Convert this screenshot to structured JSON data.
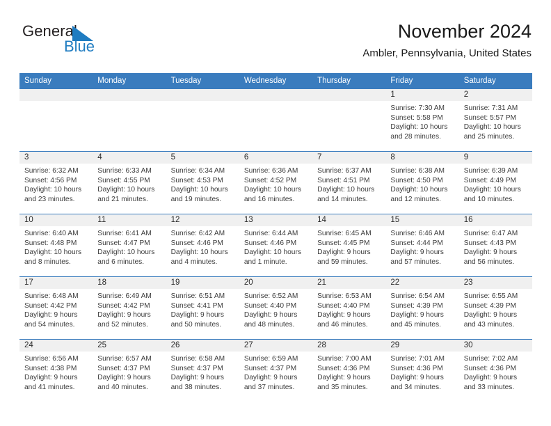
{
  "brand": {
    "name_part1": "General",
    "name_part2": "Blue",
    "triangle_color": "#1f7cc1",
    "text_color": "#231f20"
  },
  "header": {
    "title": "November 2024",
    "subtitle": "Ambler, Pennsylvania, United States"
  },
  "theme": {
    "header_blue": "#3a7cbe",
    "day_number_band": "#f0f0f0",
    "cell_background": "#ffffff",
    "body_text": "#3b3b3b"
  },
  "weekdays": [
    "Sunday",
    "Monday",
    "Tuesday",
    "Wednesday",
    "Thursday",
    "Friday",
    "Saturday"
  ],
  "weeks": [
    [
      {
        "day": "",
        "sunrise": "",
        "sunset": "",
        "daylight": ""
      },
      {
        "day": "",
        "sunrise": "",
        "sunset": "",
        "daylight": ""
      },
      {
        "day": "",
        "sunrise": "",
        "sunset": "",
        "daylight": ""
      },
      {
        "day": "",
        "sunrise": "",
        "sunset": "",
        "daylight": ""
      },
      {
        "day": "",
        "sunrise": "",
        "sunset": "",
        "daylight": ""
      },
      {
        "day": "1",
        "sunrise": "Sunrise: 7:30 AM",
        "sunset": "Sunset: 5:58 PM",
        "daylight": "Daylight: 10 hours and 28 minutes."
      },
      {
        "day": "2",
        "sunrise": "Sunrise: 7:31 AM",
        "sunset": "Sunset: 5:57 PM",
        "daylight": "Daylight: 10 hours and 25 minutes."
      }
    ],
    [
      {
        "day": "3",
        "sunrise": "Sunrise: 6:32 AM",
        "sunset": "Sunset: 4:56 PM",
        "daylight": "Daylight: 10 hours and 23 minutes."
      },
      {
        "day": "4",
        "sunrise": "Sunrise: 6:33 AM",
        "sunset": "Sunset: 4:55 PM",
        "daylight": "Daylight: 10 hours and 21 minutes."
      },
      {
        "day": "5",
        "sunrise": "Sunrise: 6:34 AM",
        "sunset": "Sunset: 4:53 PM",
        "daylight": "Daylight: 10 hours and 19 minutes."
      },
      {
        "day": "6",
        "sunrise": "Sunrise: 6:36 AM",
        "sunset": "Sunset: 4:52 PM",
        "daylight": "Daylight: 10 hours and 16 minutes."
      },
      {
        "day": "7",
        "sunrise": "Sunrise: 6:37 AM",
        "sunset": "Sunset: 4:51 PM",
        "daylight": "Daylight: 10 hours and 14 minutes."
      },
      {
        "day": "8",
        "sunrise": "Sunrise: 6:38 AM",
        "sunset": "Sunset: 4:50 PM",
        "daylight": "Daylight: 10 hours and 12 minutes."
      },
      {
        "day": "9",
        "sunrise": "Sunrise: 6:39 AM",
        "sunset": "Sunset: 4:49 PM",
        "daylight": "Daylight: 10 hours and 10 minutes."
      }
    ],
    [
      {
        "day": "10",
        "sunrise": "Sunrise: 6:40 AM",
        "sunset": "Sunset: 4:48 PM",
        "daylight": "Daylight: 10 hours and 8 minutes."
      },
      {
        "day": "11",
        "sunrise": "Sunrise: 6:41 AM",
        "sunset": "Sunset: 4:47 PM",
        "daylight": "Daylight: 10 hours and 6 minutes."
      },
      {
        "day": "12",
        "sunrise": "Sunrise: 6:42 AM",
        "sunset": "Sunset: 4:46 PM",
        "daylight": "Daylight: 10 hours and 4 minutes."
      },
      {
        "day": "13",
        "sunrise": "Sunrise: 6:44 AM",
        "sunset": "Sunset: 4:46 PM",
        "daylight": "Daylight: 10 hours and 1 minute."
      },
      {
        "day": "14",
        "sunrise": "Sunrise: 6:45 AM",
        "sunset": "Sunset: 4:45 PM",
        "daylight": "Daylight: 9 hours and 59 minutes."
      },
      {
        "day": "15",
        "sunrise": "Sunrise: 6:46 AM",
        "sunset": "Sunset: 4:44 PM",
        "daylight": "Daylight: 9 hours and 57 minutes."
      },
      {
        "day": "16",
        "sunrise": "Sunrise: 6:47 AM",
        "sunset": "Sunset: 4:43 PM",
        "daylight": "Daylight: 9 hours and 56 minutes."
      }
    ],
    [
      {
        "day": "17",
        "sunrise": "Sunrise: 6:48 AM",
        "sunset": "Sunset: 4:42 PM",
        "daylight": "Daylight: 9 hours and 54 minutes."
      },
      {
        "day": "18",
        "sunrise": "Sunrise: 6:49 AM",
        "sunset": "Sunset: 4:42 PM",
        "daylight": "Daylight: 9 hours and 52 minutes."
      },
      {
        "day": "19",
        "sunrise": "Sunrise: 6:51 AM",
        "sunset": "Sunset: 4:41 PM",
        "daylight": "Daylight: 9 hours and 50 minutes."
      },
      {
        "day": "20",
        "sunrise": "Sunrise: 6:52 AM",
        "sunset": "Sunset: 4:40 PM",
        "daylight": "Daylight: 9 hours and 48 minutes."
      },
      {
        "day": "21",
        "sunrise": "Sunrise: 6:53 AM",
        "sunset": "Sunset: 4:40 PM",
        "daylight": "Daylight: 9 hours and 46 minutes."
      },
      {
        "day": "22",
        "sunrise": "Sunrise: 6:54 AM",
        "sunset": "Sunset: 4:39 PM",
        "daylight": "Daylight: 9 hours and 45 minutes."
      },
      {
        "day": "23",
        "sunrise": "Sunrise: 6:55 AM",
        "sunset": "Sunset: 4:39 PM",
        "daylight": "Daylight: 9 hours and 43 minutes."
      }
    ],
    [
      {
        "day": "24",
        "sunrise": "Sunrise: 6:56 AM",
        "sunset": "Sunset: 4:38 PM",
        "daylight": "Daylight: 9 hours and 41 minutes."
      },
      {
        "day": "25",
        "sunrise": "Sunrise: 6:57 AM",
        "sunset": "Sunset: 4:37 PM",
        "daylight": "Daylight: 9 hours and 40 minutes."
      },
      {
        "day": "26",
        "sunrise": "Sunrise: 6:58 AM",
        "sunset": "Sunset: 4:37 PM",
        "daylight": "Daylight: 9 hours and 38 minutes."
      },
      {
        "day": "27",
        "sunrise": "Sunrise: 6:59 AM",
        "sunset": "Sunset: 4:37 PM",
        "daylight": "Daylight: 9 hours and 37 minutes."
      },
      {
        "day": "28",
        "sunrise": "Sunrise: 7:00 AM",
        "sunset": "Sunset: 4:36 PM",
        "daylight": "Daylight: 9 hours and 35 minutes."
      },
      {
        "day": "29",
        "sunrise": "Sunrise: 7:01 AM",
        "sunset": "Sunset: 4:36 PM",
        "daylight": "Daylight: 9 hours and 34 minutes."
      },
      {
        "day": "30",
        "sunrise": "Sunrise: 7:02 AM",
        "sunset": "Sunset: 4:36 PM",
        "daylight": "Daylight: 9 hours and 33 minutes."
      }
    ]
  ]
}
